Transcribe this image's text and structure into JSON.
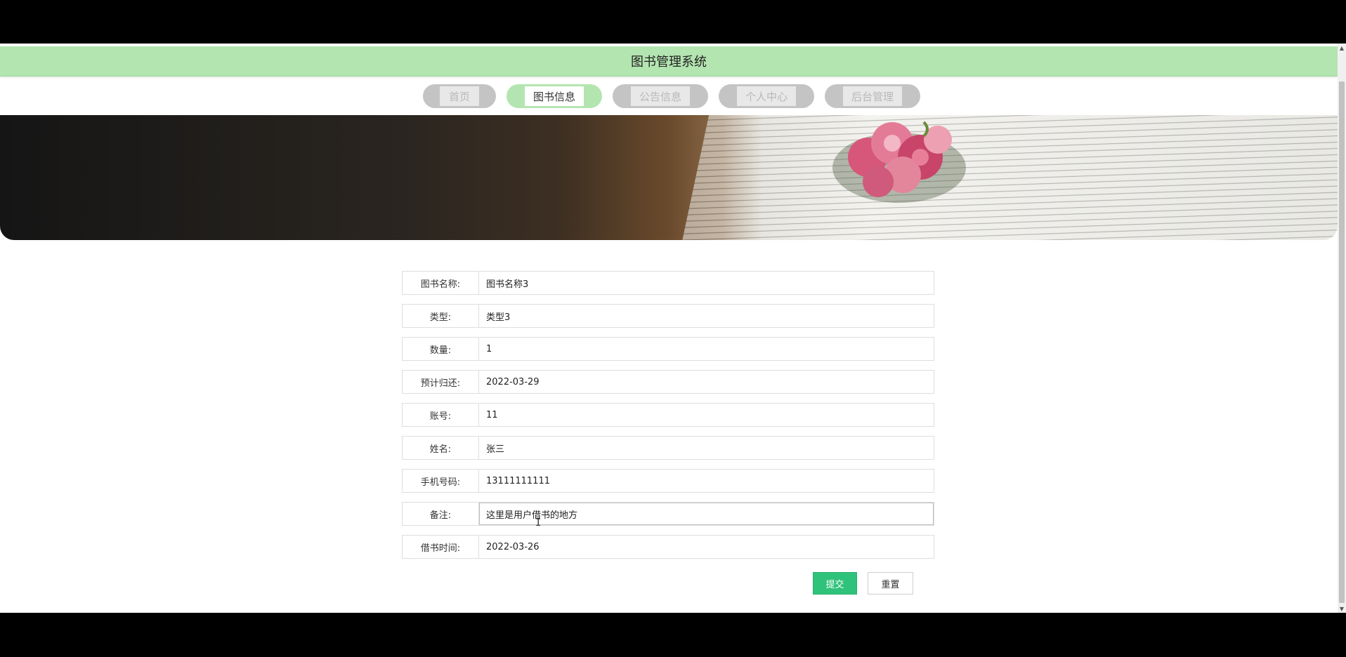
{
  "header": {
    "title": "图书管理系统"
  },
  "nav": {
    "items": [
      {
        "label": "首页",
        "active": false
      },
      {
        "label": "图书信息",
        "active": true
      },
      {
        "label": "公告信息",
        "active": false
      },
      {
        "label": "个人中心",
        "active": false
      },
      {
        "label": "后台管理",
        "active": false
      }
    ]
  },
  "form": {
    "fields": [
      {
        "label": "图书名称:",
        "value": "图书名称3"
      },
      {
        "label": "类型:",
        "value": "类型3"
      },
      {
        "label": "数量:",
        "value": "1"
      },
      {
        "label": "预计归还:",
        "value": "2022-03-29"
      },
      {
        "label": "账号:",
        "value": "11"
      },
      {
        "label": "姓名:",
        "value": "张三"
      },
      {
        "label": "手机号码:",
        "value": "13111111111"
      },
      {
        "label": "备注:",
        "value": "这里是用户借书的地方"
      },
      {
        "label": "借书时间:",
        "value": "2022-03-26"
      }
    ],
    "submit_label": "提交",
    "reset_label": "重置"
  },
  "colors": {
    "header_bg": "#b3e5b0",
    "submit_bg": "#2fc27a"
  }
}
